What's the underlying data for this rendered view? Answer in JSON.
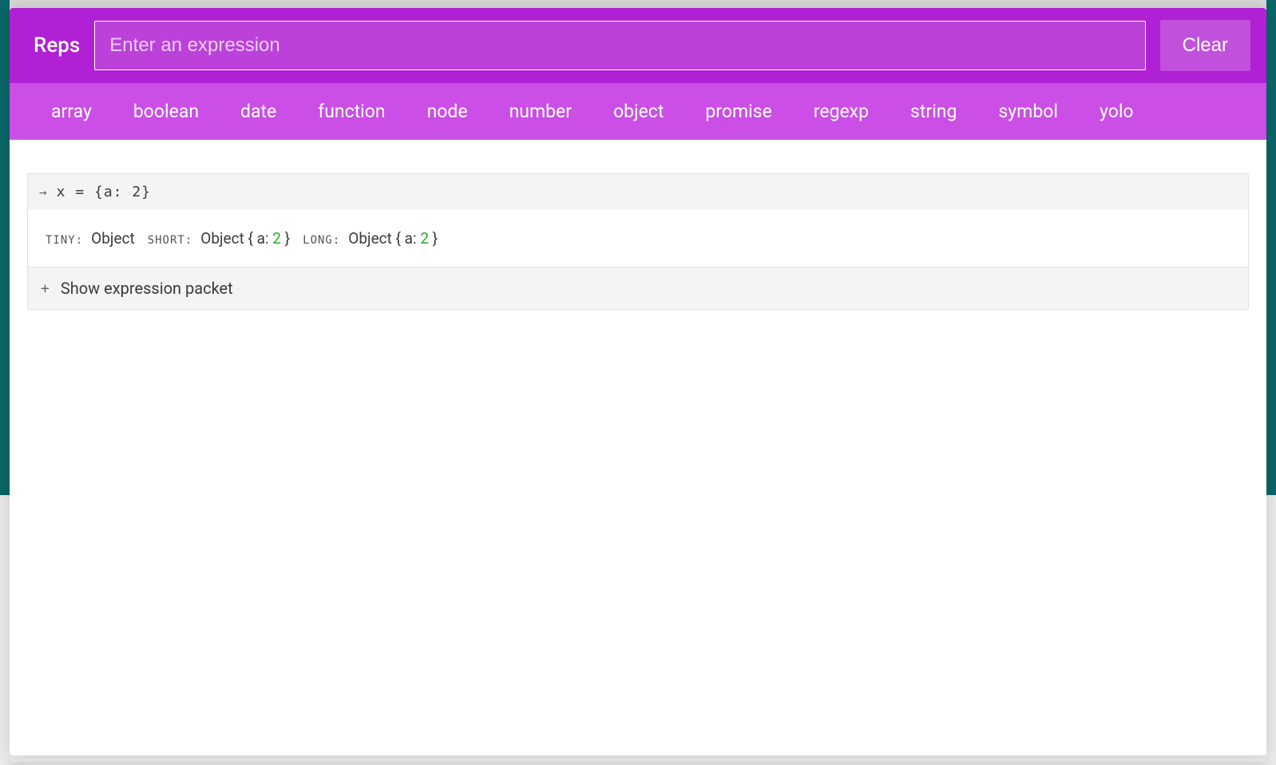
{
  "header": {
    "title": "Reps",
    "input_placeholder": "Enter an expression",
    "input_value": "",
    "clear_label": "Clear"
  },
  "tabs": [
    "array",
    "boolean",
    "date",
    "function",
    "node",
    "number",
    "object",
    "promise",
    "regexp",
    "string",
    "symbol",
    "yolo"
  ],
  "expression": {
    "code": "x = {a: 2}",
    "reps": {
      "tiny_label": "tiny:",
      "tiny_value": "Object",
      "short_label": "short:",
      "short_prefix": "Object { a: ",
      "short_num": "2",
      "short_suffix": " }",
      "long_label": "long:",
      "long_prefix": "Object { a: ",
      "long_num": "2",
      "long_suffix": " }"
    },
    "packet_label": "Show expression packet"
  }
}
